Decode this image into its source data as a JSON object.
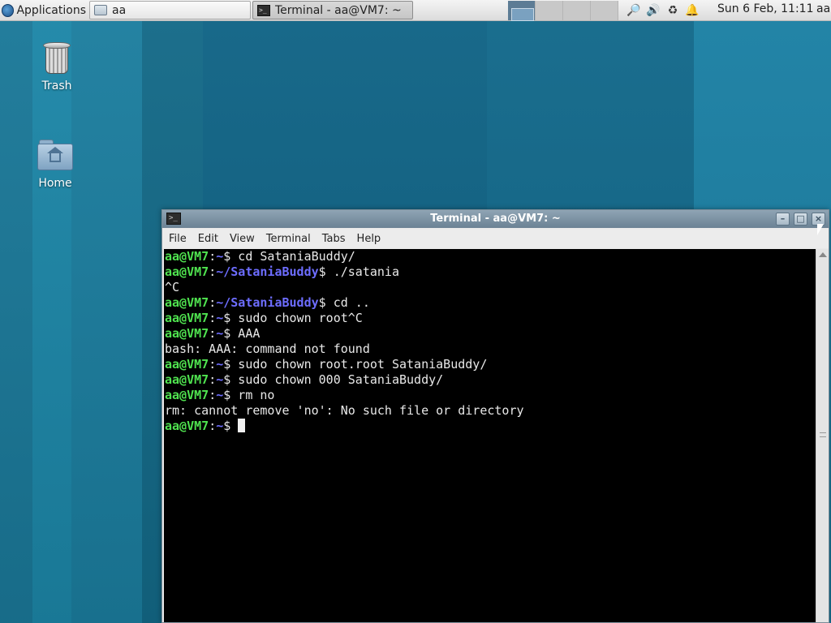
{
  "panel": {
    "applications_label": "Applications",
    "tasks": [
      {
        "label": "aa"
      },
      {
        "label": "Terminal - aa@VM7: ~"
      }
    ],
    "clock": "Sun  6 Feb, 11:11",
    "user": "aa"
  },
  "desktop": {
    "icons": [
      {
        "label": "Trash"
      },
      {
        "label": "Home"
      }
    ]
  },
  "window": {
    "title": "Terminal - aa@VM7: ~",
    "menu": [
      "File",
      "Edit",
      "View",
      "Terminal",
      "Tabs",
      "Help"
    ]
  },
  "terminal": {
    "lines": [
      {
        "user": "aa@VM7",
        "path": "~",
        "cmd": "$ cd SataniaBuddy/"
      },
      {
        "user": "aa@VM7",
        "path": "~/SataniaBuddy",
        "cmd": "$ ./satania"
      },
      {
        "out": "^C"
      },
      {
        "user": "aa@VM7",
        "path": "~/SataniaBuddy",
        "cmd": "$ cd .."
      },
      {
        "user": "aa@VM7",
        "path": "~",
        "cmd": "$ sudo chown root^C"
      },
      {
        "user": "aa@VM7",
        "path": "~",
        "cmd": "$ AAA"
      },
      {
        "out": "bash: AAA: command not found"
      },
      {
        "user": "aa@VM7",
        "path": "~",
        "cmd": "$ sudo chown root.root SataniaBuddy/"
      },
      {
        "user": "aa@VM7",
        "path": "~",
        "cmd": "$ sudo chown 000 SataniaBuddy/"
      },
      {
        "user": "aa@VM7",
        "path": "~",
        "cmd": "$ rm no"
      },
      {
        "out": "rm: cannot remove 'no': No such file or directory"
      },
      {
        "user": "aa@VM7",
        "path": "~",
        "cmd": "$ "
      }
    ]
  }
}
